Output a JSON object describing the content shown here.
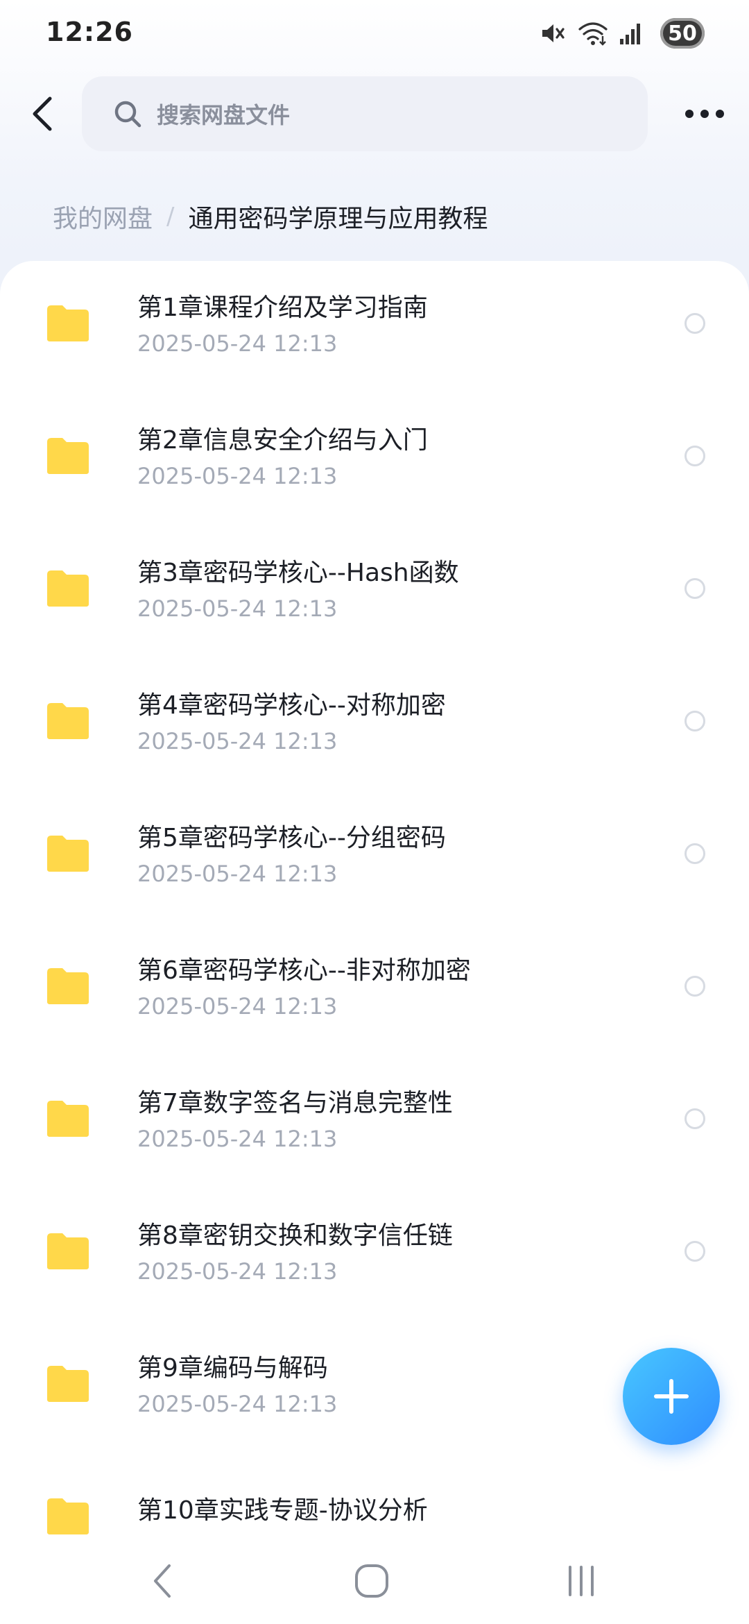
{
  "status_bar": {
    "time": "12:26",
    "battery": "50",
    "icons": [
      "mute-icon",
      "wifi-icon",
      "signal-icon"
    ]
  },
  "header": {
    "search_placeholder": "搜索网盘文件",
    "icons": [
      "back-icon",
      "search-icon",
      "more-icon"
    ]
  },
  "breadcrumb": {
    "root": "我的网盘",
    "separator": "/",
    "current": "通用密码学原理与应用教程"
  },
  "files": [
    {
      "name": "第1章课程介绍及学习指南",
      "date": "2025-05-24  12:13"
    },
    {
      "name": "第2章信息安全介绍与入门",
      "date": "2025-05-24  12:13"
    },
    {
      "name": "第3章密码学核心--Hash函数",
      "date": "2025-05-24  12:13"
    },
    {
      "name": "第4章密码学核心--对称加密",
      "date": "2025-05-24  12:13"
    },
    {
      "name": "第5章密码学核心--分组密码",
      "date": "2025-05-24  12:13"
    },
    {
      "name": "第6章密码学核心--非对称加密",
      "date": "2025-05-24  12:13"
    },
    {
      "name": "第7章数字签名与消息完整性",
      "date": "2025-05-24  12:13"
    },
    {
      "name": "第8章密钥交换和数字信任链",
      "date": "2025-05-24  12:13"
    },
    {
      "name": "第9章编码与解码",
      "date": "2025-05-24  12:13"
    },
    {
      "name": "第10章实践专题-协议分析",
      "date": ""
    }
  ],
  "colors": {
    "folder": "#FFD84A",
    "accent": "#2F8DFF",
    "text_primary": "#1C1F26",
    "text_secondary": "#A4AAB6"
  },
  "fab": {
    "icon": "plus-icon"
  },
  "nav_bar": {
    "icons": [
      "nav-back-icon",
      "nav-home-icon",
      "nav-recents-icon"
    ]
  }
}
